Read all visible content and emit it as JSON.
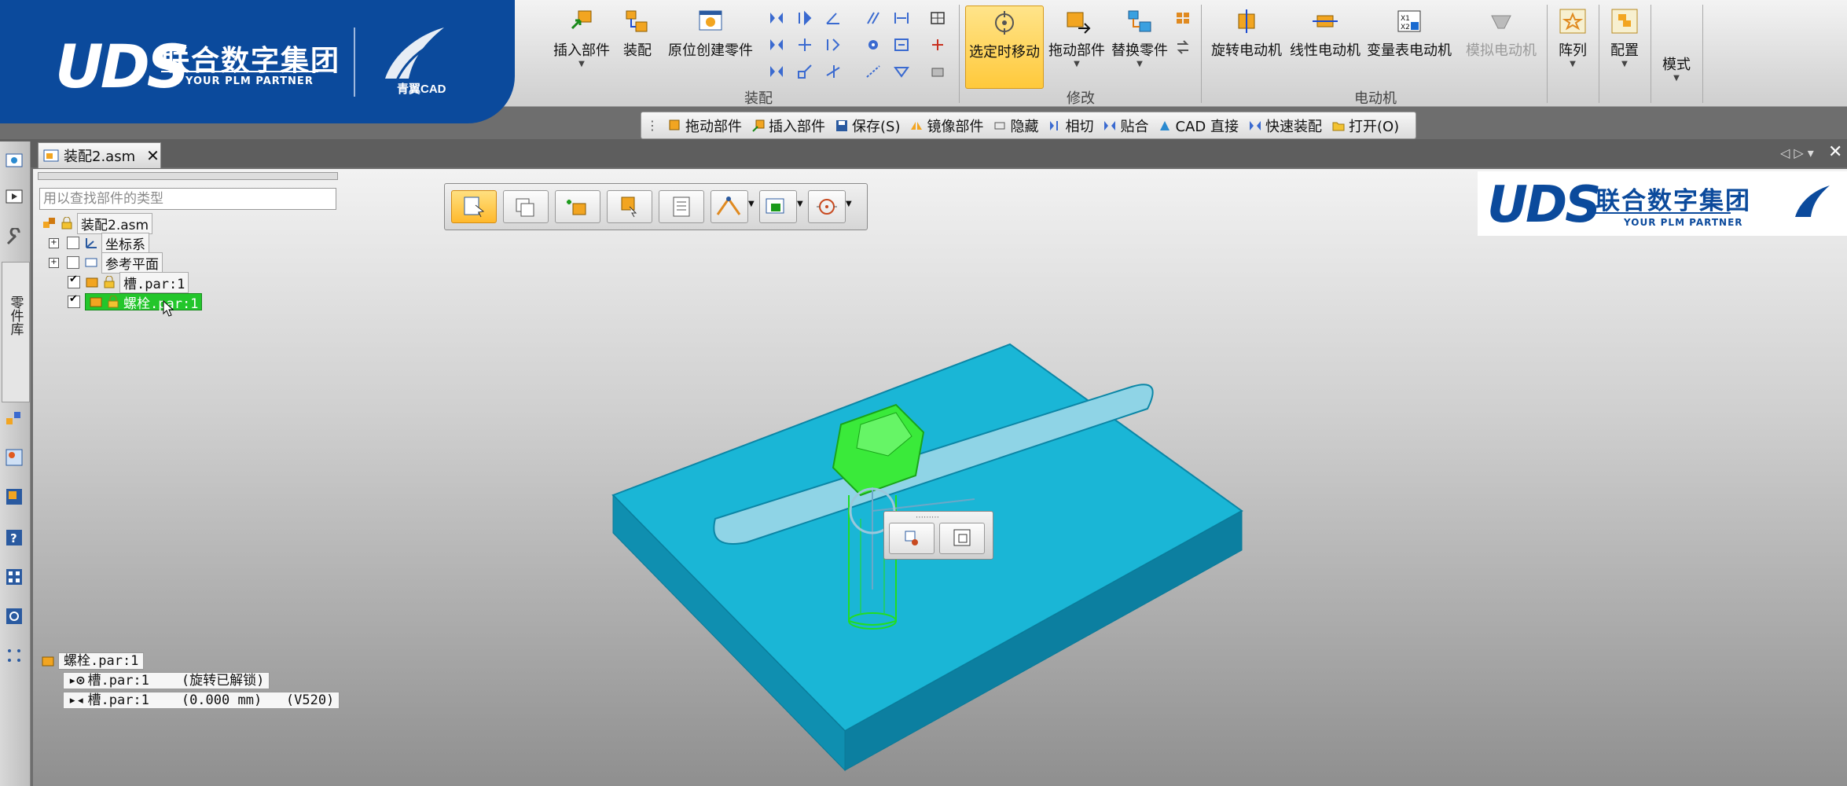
{
  "brand": {
    "logo_text": "UDS",
    "company": "联合数字集团",
    "tagline": "YOUR PLM PARTNER",
    "product": "青翼CAD"
  },
  "ribbon": {
    "buttons": {
      "insert_part": "插入部件",
      "assemble": "装配",
      "create_in_place": "原位创建零件",
      "move_on_select": "选定时移动",
      "drag_part": "拖动部件",
      "replace_part": "替换零件",
      "rotary_motor": "旋转电动机",
      "linear_motor": "线性电动机",
      "variable_table_motor": "变量表电动机",
      "simulate_motor": "模拟电动机",
      "pattern": "阵列",
      "configuration": "配置",
      "modes": "模式"
    },
    "groups": {
      "assembly": "装配",
      "modify": "修改",
      "motors": "电动机"
    }
  },
  "quickbar": {
    "items": [
      "拖动部件",
      "插入部件",
      "保存(S)",
      "镜像部件",
      "隐藏",
      "相切",
      "贴合",
      "CAD 直接",
      "快速装配",
      "打开(O)"
    ]
  },
  "document": {
    "tab_title": "装配2.asm",
    "close": "✕"
  },
  "left_rail": {
    "library_label": "零件库"
  },
  "tree": {
    "search_placeholder": "用以查找部件的类型",
    "root": "装配2.asm",
    "nodes": [
      {
        "label": "坐标系",
        "checked": false,
        "expander": "+"
      },
      {
        "label": "参考平面",
        "checked": false,
        "expander": "+"
      },
      {
        "label": "槽.par:1",
        "checked": true
      },
      {
        "label": "螺栓.par:1",
        "checked": true,
        "selected": true
      }
    ]
  },
  "relationships": {
    "title": "螺栓.par:1",
    "rows": [
      "槽.par:1    (旋转已解锁)",
      "槽.par:1    (0.000 mm)   (V520)"
    ]
  },
  "colors": {
    "brand_blue": "#0b4a9c",
    "highlight_yellow": "#ffc93b",
    "selected_green": "#22c22a",
    "plate_cyan": "#1ab0d0"
  }
}
